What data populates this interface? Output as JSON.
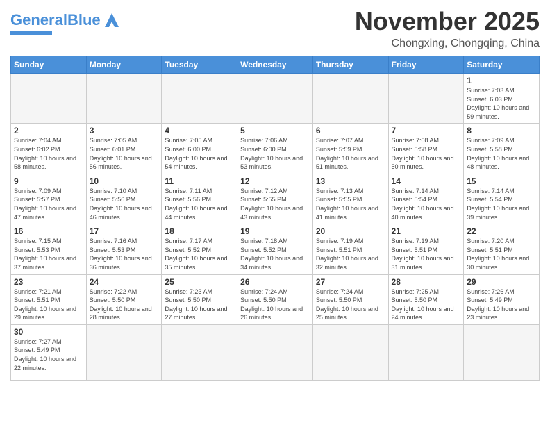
{
  "header": {
    "logo_general": "General",
    "logo_blue": "Blue",
    "month_title": "November 2025",
    "location": "Chongxing, Chongqing, China"
  },
  "days_of_week": [
    "Sunday",
    "Monday",
    "Tuesday",
    "Wednesday",
    "Thursday",
    "Friday",
    "Saturday"
  ],
  "weeks": [
    [
      {
        "day": "",
        "info": ""
      },
      {
        "day": "",
        "info": ""
      },
      {
        "day": "",
        "info": ""
      },
      {
        "day": "",
        "info": ""
      },
      {
        "day": "",
        "info": ""
      },
      {
        "day": "",
        "info": ""
      },
      {
        "day": "1",
        "info": "Sunrise: 7:03 AM\nSunset: 6:03 PM\nDaylight: 10 hours and 59 minutes."
      }
    ],
    [
      {
        "day": "2",
        "info": "Sunrise: 7:04 AM\nSunset: 6:02 PM\nDaylight: 10 hours and 58 minutes."
      },
      {
        "day": "3",
        "info": "Sunrise: 7:05 AM\nSunset: 6:01 PM\nDaylight: 10 hours and 56 minutes."
      },
      {
        "day": "4",
        "info": "Sunrise: 7:05 AM\nSunset: 6:00 PM\nDaylight: 10 hours and 54 minutes."
      },
      {
        "day": "5",
        "info": "Sunrise: 7:06 AM\nSunset: 6:00 PM\nDaylight: 10 hours and 53 minutes."
      },
      {
        "day": "6",
        "info": "Sunrise: 7:07 AM\nSunset: 5:59 PM\nDaylight: 10 hours and 51 minutes."
      },
      {
        "day": "7",
        "info": "Sunrise: 7:08 AM\nSunset: 5:58 PM\nDaylight: 10 hours and 50 minutes."
      },
      {
        "day": "8",
        "info": "Sunrise: 7:09 AM\nSunset: 5:58 PM\nDaylight: 10 hours and 48 minutes."
      }
    ],
    [
      {
        "day": "9",
        "info": "Sunrise: 7:09 AM\nSunset: 5:57 PM\nDaylight: 10 hours and 47 minutes."
      },
      {
        "day": "10",
        "info": "Sunrise: 7:10 AM\nSunset: 5:56 PM\nDaylight: 10 hours and 46 minutes."
      },
      {
        "day": "11",
        "info": "Sunrise: 7:11 AM\nSunset: 5:56 PM\nDaylight: 10 hours and 44 minutes."
      },
      {
        "day": "12",
        "info": "Sunrise: 7:12 AM\nSunset: 5:55 PM\nDaylight: 10 hours and 43 minutes."
      },
      {
        "day": "13",
        "info": "Sunrise: 7:13 AM\nSunset: 5:55 PM\nDaylight: 10 hours and 41 minutes."
      },
      {
        "day": "14",
        "info": "Sunrise: 7:14 AM\nSunset: 5:54 PM\nDaylight: 10 hours and 40 minutes."
      },
      {
        "day": "15",
        "info": "Sunrise: 7:14 AM\nSunset: 5:54 PM\nDaylight: 10 hours and 39 minutes."
      }
    ],
    [
      {
        "day": "16",
        "info": "Sunrise: 7:15 AM\nSunset: 5:53 PM\nDaylight: 10 hours and 37 minutes."
      },
      {
        "day": "17",
        "info": "Sunrise: 7:16 AM\nSunset: 5:53 PM\nDaylight: 10 hours and 36 minutes."
      },
      {
        "day": "18",
        "info": "Sunrise: 7:17 AM\nSunset: 5:52 PM\nDaylight: 10 hours and 35 minutes."
      },
      {
        "day": "19",
        "info": "Sunrise: 7:18 AM\nSunset: 5:52 PM\nDaylight: 10 hours and 34 minutes."
      },
      {
        "day": "20",
        "info": "Sunrise: 7:19 AM\nSunset: 5:51 PM\nDaylight: 10 hours and 32 minutes."
      },
      {
        "day": "21",
        "info": "Sunrise: 7:19 AM\nSunset: 5:51 PM\nDaylight: 10 hours and 31 minutes."
      },
      {
        "day": "22",
        "info": "Sunrise: 7:20 AM\nSunset: 5:51 PM\nDaylight: 10 hours and 30 minutes."
      }
    ],
    [
      {
        "day": "23",
        "info": "Sunrise: 7:21 AM\nSunset: 5:51 PM\nDaylight: 10 hours and 29 minutes."
      },
      {
        "day": "24",
        "info": "Sunrise: 7:22 AM\nSunset: 5:50 PM\nDaylight: 10 hours and 28 minutes."
      },
      {
        "day": "25",
        "info": "Sunrise: 7:23 AM\nSunset: 5:50 PM\nDaylight: 10 hours and 27 minutes."
      },
      {
        "day": "26",
        "info": "Sunrise: 7:24 AM\nSunset: 5:50 PM\nDaylight: 10 hours and 26 minutes."
      },
      {
        "day": "27",
        "info": "Sunrise: 7:24 AM\nSunset: 5:50 PM\nDaylight: 10 hours and 25 minutes."
      },
      {
        "day": "28",
        "info": "Sunrise: 7:25 AM\nSunset: 5:50 PM\nDaylight: 10 hours and 24 minutes."
      },
      {
        "day": "29",
        "info": "Sunrise: 7:26 AM\nSunset: 5:49 PM\nDaylight: 10 hours and 23 minutes."
      }
    ],
    [
      {
        "day": "30",
        "info": "Sunrise: 7:27 AM\nSunset: 5:49 PM\nDaylight: 10 hours and 22 minutes."
      },
      {
        "day": "",
        "info": ""
      },
      {
        "day": "",
        "info": ""
      },
      {
        "day": "",
        "info": ""
      },
      {
        "day": "",
        "info": ""
      },
      {
        "day": "",
        "info": ""
      },
      {
        "day": "",
        "info": ""
      }
    ]
  ]
}
